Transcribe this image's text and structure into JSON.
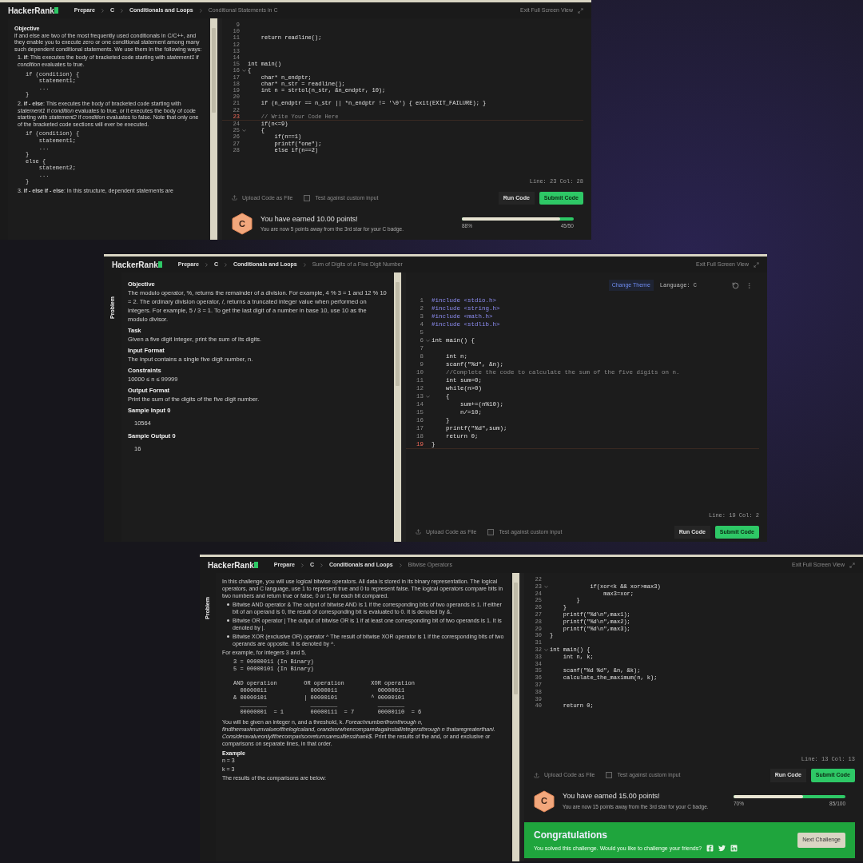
{
  "panels": [
    {
      "header": {
        "logo": "HackerRank",
        "crumbs": [
          "Prepare",
          "C",
          "Conditionals and Loops"
        ],
        "current": "Conditional Statements in C",
        "exit": "Exit Full Screen View"
      },
      "problem": [
        {
          "kind": "heading",
          "text": "Objective"
        },
        {
          "kind": "para",
          "text": "if and else are two of the most frequently used conditionals in C/C++, and they enable you to execute zero or one conditional statement among many such dependent conditional statements. We use them in the following ways:"
        },
        {
          "kind": "item",
          "text": "1. **if**: This executes the body of bracketed code starting with *statement1* if *condition* evaluates to true."
        },
        {
          "kind": "code",
          "text": "if (condition) {\n    statement1;\n    ...\n}"
        },
        {
          "kind": "item",
          "text": "2. **if - else**: This executes the body of bracketed code starting with *statement1* if *condition* evaluates to true, or it executes the body of code starting with *statement2* if *condition* evaluates to false. Note that only one of the bracketed code sections will ever be executed."
        },
        {
          "kind": "code",
          "text": "if (condition) {\n    statement1;\n    ...\n}\nelse {\n    statement2;\n    ...\n}"
        },
        {
          "kind": "item",
          "text": "3. **if - else if - else**: In this structure, dependent statements are"
        }
      ],
      "editor": {
        "lines": [
          {
            "n": "9",
            "fold": false,
            "current": false
          },
          {
            "n": "10",
            "fold": false,
            "current": false
          },
          {
            "n": "11",
            "text": "    return readline();",
            "kind": "code",
            "fold": false,
            "current": false
          },
          {
            "n": "12",
            "fold": false,
            "current": false
          },
          {
            "n": "13",
            "fold": false,
            "current": false
          },
          {
            "n": "14",
            "fold": false,
            "current": false
          },
          {
            "n": "15",
            "text": "int main()",
            "kind": "code",
            "fold": false,
            "current": false
          },
          {
            "n": "16",
            "text": "{",
            "kind": "code",
            "fold": true,
            "current": false
          },
          {
            "n": "17",
            "text": "    char* n_endptr;",
            "kind": "code",
            "fold": false,
            "current": false
          },
          {
            "n": "18",
            "text": "    char* n_str = readline();",
            "kind": "code",
            "fold": false,
            "current": false
          },
          {
            "n": "19",
            "text": "    int n = strtol(n_str, &n_endptr, 10);",
            "kind": "code",
            "fold": false,
            "current": false
          },
          {
            "n": "20",
            "fold": false,
            "current": false
          },
          {
            "n": "21",
            "text": "    if (n_endptr == n_str || *n_endptr != '\\0') { exit(EXIT_FAILURE); }",
            "kind": "code",
            "fold": false,
            "current": false
          },
          {
            "n": "22",
            "fold": false,
            "current": false
          },
          {
            "n": "23",
            "text": "    // Write Your Code Here",
            "kind": "comment",
            "fold": false,
            "current": true
          },
          {
            "n": "24",
            "text": "    if(n<=9)",
            "kind": "code",
            "fold": false,
            "current": false
          },
          {
            "n": "25",
            "text": "    {",
            "kind": "code",
            "fold": true,
            "current": false
          },
          {
            "n": "26",
            "text": "        if(n==1)",
            "kind": "code",
            "fold": false,
            "current": false
          },
          {
            "n": "27",
            "text": "        printf(\"one\");",
            "kind": "code",
            "fold": false,
            "current": false
          },
          {
            "n": "28",
            "text": "        else if(n==2)",
            "kind": "code",
            "fold": false,
            "current": false
          }
        ],
        "cursor": "Line: 23 Col: 28",
        "upload": "Upload Code as File",
        "custom": "Test against custom input",
        "custom_checked": false,
        "run": "Run Code",
        "submit": "Submit Code"
      },
      "result": {
        "badge": "C",
        "earned": "You have earned 10.00 points!",
        "note": "You are now 5 points away from the 3rd star for your C badge.",
        "level": 0.88,
        "percent": "88%",
        "score": "45/50"
      }
    },
    {
      "header": {
        "logo": "HackerRank",
        "crumbs": [
          "Prepare",
          "C",
          "Conditionals and Loops"
        ],
        "current": "Sum of Digits of a Five Digit Number",
        "exit": "Exit Full Screen View"
      },
      "side_tabs": [
        {
          "label": "Problem",
          "selected": true
        }
      ],
      "problem": [
        {
          "kind": "heading",
          "text": "Objective"
        },
        {
          "kind": "para",
          "text": "The modulo operator, %, returns the remainder of a division. For example, 4 % 3 = 1 and 12 % 10 = 2. The ordinary division operator, /, returns a truncated integer value when performed on integers. For example, 5 / 3 = 1. To get the last digit of a number in base 10, use 10 as the modulo divisor."
        },
        {
          "kind": "heading",
          "text": "Task"
        },
        {
          "kind": "para",
          "text": "Given a five digit integer, print the sum of its digits."
        },
        {
          "kind": "heading",
          "text": "Input Format"
        },
        {
          "kind": "para",
          "text": "The input contains a single five digit number, n."
        },
        {
          "kind": "heading",
          "text": "Constraints"
        },
        {
          "kind": "para",
          "text": "10000 ≤ n ≤ 99999"
        },
        {
          "kind": "heading",
          "text": "Output Format"
        },
        {
          "kind": "para",
          "text": "Print the sum of the digits of the five digit number."
        },
        {
          "kind": "heading",
          "text": "Sample Input 0"
        },
        {
          "kind": "sample",
          "text": "10564"
        },
        {
          "kind": "heading",
          "text": "Sample Output 0"
        },
        {
          "kind": "sample",
          "text": "16"
        }
      ],
      "editor": {
        "toolbar": {
          "theme": "Change Theme",
          "language": "Language: C"
        },
        "lines": [
          {
            "n": "1",
            "text": "#include <stdio.h>",
            "kind": "include",
            "fold": false,
            "current": false
          },
          {
            "n": "2",
            "text": "#include <string.h>",
            "kind": "include",
            "fold": false,
            "current": false
          },
          {
            "n": "3",
            "text": "#include <math.h>",
            "kind": "include",
            "fold": false,
            "current": false
          },
          {
            "n": "4",
            "text": "#include <stdlib.h>",
            "kind": "include",
            "fold": false,
            "current": false
          },
          {
            "n": "5",
            "fold": false,
            "current": false
          },
          {
            "n": "6",
            "text": "int main() {",
            "kind": "code",
            "fold": true,
            "current": false
          },
          {
            "n": "7",
            "fold": false,
            "current": false
          },
          {
            "n": "8",
            "text": "    int n;",
            "kind": "code",
            "fold": false,
            "current": false
          },
          {
            "n": "9",
            "text": "    scanf(\"%d\", &n);",
            "kind": "code",
            "fold": false,
            "current": false
          },
          {
            "n": "10",
            "text": "    //Complete the code to calculate the sum of the five digits on n.",
            "kind": "comment",
            "fold": false,
            "current": false
          },
          {
            "n": "11",
            "text": "    int sum=0;",
            "kind": "code",
            "fold": false,
            "current": false
          },
          {
            "n": "12",
            "text": "    while(n>0)",
            "kind": "code",
            "fold": false,
            "current": false
          },
          {
            "n": "13",
            "text": "    {",
            "kind": "code",
            "fold": true,
            "current": false
          },
          {
            "n": "14",
            "text": "        sum+=(n%10);",
            "kind": "code",
            "fold": false,
            "current": false
          },
          {
            "n": "15",
            "text": "        n/=10;",
            "kind": "code",
            "fold": false,
            "current": false
          },
          {
            "n": "16",
            "text": "    }",
            "kind": "code",
            "fold": false,
            "current": false
          },
          {
            "n": "17",
            "text": "    printf(\"%d\",sum);",
            "kind": "code",
            "fold": false,
            "current": false
          },
          {
            "n": "18",
            "text": "    return 0;",
            "kind": "code",
            "fold": false,
            "current": false
          },
          {
            "n": "19",
            "text": "}",
            "kind": "code",
            "fold": false,
            "current": true
          }
        ],
        "cursor": "Line: 19 Col: 2",
        "upload": "Upload Code as File",
        "custom": "Test against custom input",
        "custom_checked": false,
        "run": "Run Code",
        "submit": "Submit Code"
      }
    },
    {
      "header": {
        "logo": "HackerRank",
        "crumbs": [
          "Prepare",
          "C",
          "Conditionals and Loops"
        ],
        "current": "Bitwise Operators",
        "exit": "Exit Full Screen View"
      },
      "side_tabs": [
        {
          "label": "Problem",
          "selected": true
        }
      ],
      "problem": [
        {
          "kind": "para",
          "text": "In this challenge, you will use logical bitwise operators. All data is stored in its binary representation. The logical operators, and C language, use 1 to represent true and 0 to represent false. The logical operators compare bits in two numbers and return true or false, 0 or 1, for each bit compared."
        },
        {
          "kind": "bullet",
          "text": "Bitwise AND operator & The output of bitwise AND is 1 if the corresponding bits of two operands is 1. If either bit of an operand is 0, the result of corresponding bit is evaluated to 0. It is denoted by &."
        },
        {
          "kind": "bullet",
          "text": "Bitwise OR operator | The output of bitwise OR is 1 if at least one corresponding bit of two operands is 1. It is denoted by |."
        },
        {
          "kind": "bullet",
          "text": "Bitwise XOR (exclusive OR) operator ^ The result of bitwise XOR operator is 1 if the corresponding bits of two operands are opposite. It is denoted by ^."
        },
        {
          "kind": "para",
          "text": "For example, for integers 3 and 5,"
        },
        {
          "kind": "code",
          "text": "3 = 00000011 (In Binary)\n5 = 00000101 (In Binary)\n\nAND operation        OR operation        XOR operation\n  00000011             00000011            00000011\n& 00000101           | 00000101          ^ 00000101\n  ________             ________            ________\n  00000001  = 1        00000111  = 7       00000110  = 6"
        },
        {
          "kind": "para",
          "text": "You will be given an integer n, and a threshold, k. *Foreachnumberifromthrough n, findthemaximumvalueofthelogicaland, orandxorwhencomparedagainstallintegersthrough n thataregreaterthani. Consideravalueonlyifthecomparisonreturnsaresultlessthank$.* Print the results of the and, or and exclusive or comparisons on separate lines, in that order."
        },
        {
          "kind": "heading",
          "text": "Example"
        },
        {
          "kind": "para",
          "text": "n = 3"
        },
        {
          "kind": "para",
          "text": "k = 3"
        },
        {
          "kind": "para",
          "text": "The results of the comparisons are below:"
        }
      ],
      "editor": {
        "lines": [
          {
            "n": "22",
            "fold": false,
            "current": false
          },
          {
            "n": "23",
            "text": "            if(xor<k && xor>max3)",
            "kind": "code",
            "fold": true,
            "current": false
          },
          {
            "n": "24",
            "text": "                max3=xor;",
            "kind": "code",
            "fold": false,
            "current": false
          },
          {
            "n": "25",
            "text": "        }",
            "kind": "code",
            "fold": false,
            "current": false
          },
          {
            "n": "26",
            "text": "    }",
            "kind": "code",
            "fold": false,
            "current": false
          },
          {
            "n": "27",
            "text": "    printf(\"%d\\n\",max1);",
            "kind": "code",
            "fold": false,
            "current": false
          },
          {
            "n": "28",
            "text": "    printf(\"%d\\n\",max2);",
            "kind": "code",
            "fold": false,
            "current": false
          },
          {
            "n": "29",
            "text": "    printf(\"%d\\n\",max3);",
            "kind": "code",
            "fold": false,
            "current": false
          },
          {
            "n": "30",
            "text": "}",
            "kind": "code",
            "fold": false,
            "current": false
          },
          {
            "n": "31",
            "fold": false,
            "current": false
          },
          {
            "n": "32",
            "text": "int main() {",
            "kind": "code",
            "fold": true,
            "current": false
          },
          {
            "n": "33",
            "text": "    int n, k;",
            "kind": "code",
            "fold": false,
            "current": false
          },
          {
            "n": "34",
            "fold": false,
            "current": false
          },
          {
            "n": "35",
            "text": "    scanf(\"%d %d\", &n, &k);",
            "kind": "code",
            "fold": false,
            "current": false
          },
          {
            "n": "36",
            "text": "    calculate_the_maximum(n, k);",
            "kind": "code",
            "fold": false,
            "current": false
          },
          {
            "n": "37",
            "fold": false,
            "current": false
          },
          {
            "n": "38",
            "fold": false,
            "current": false
          },
          {
            "n": "39",
            "fold": false,
            "current": false
          },
          {
            "n": "40",
            "text": "    return 0;",
            "kind": "code",
            "fold": false,
            "current": false
          }
        ],
        "cursor": "Line: 13 Col: 13",
        "upload": "Upload Code as File",
        "custom": "Test against custom input",
        "custom_checked": false,
        "run": "Run Code",
        "submit": "Submit Code"
      },
      "result": {
        "badge": "C",
        "earned": "You have earned 15.00 points!",
        "note": "You are now 15 points away from the 3rd star for your C badge.",
        "level": 0.62,
        "percent": "70%",
        "score": "85/100"
      },
      "congrats": {
        "title": "Congratulations",
        "text": "You solved this challenge. Would you like to challenge your friends?",
        "button": "Next Challenge"
      }
    }
  ]
}
